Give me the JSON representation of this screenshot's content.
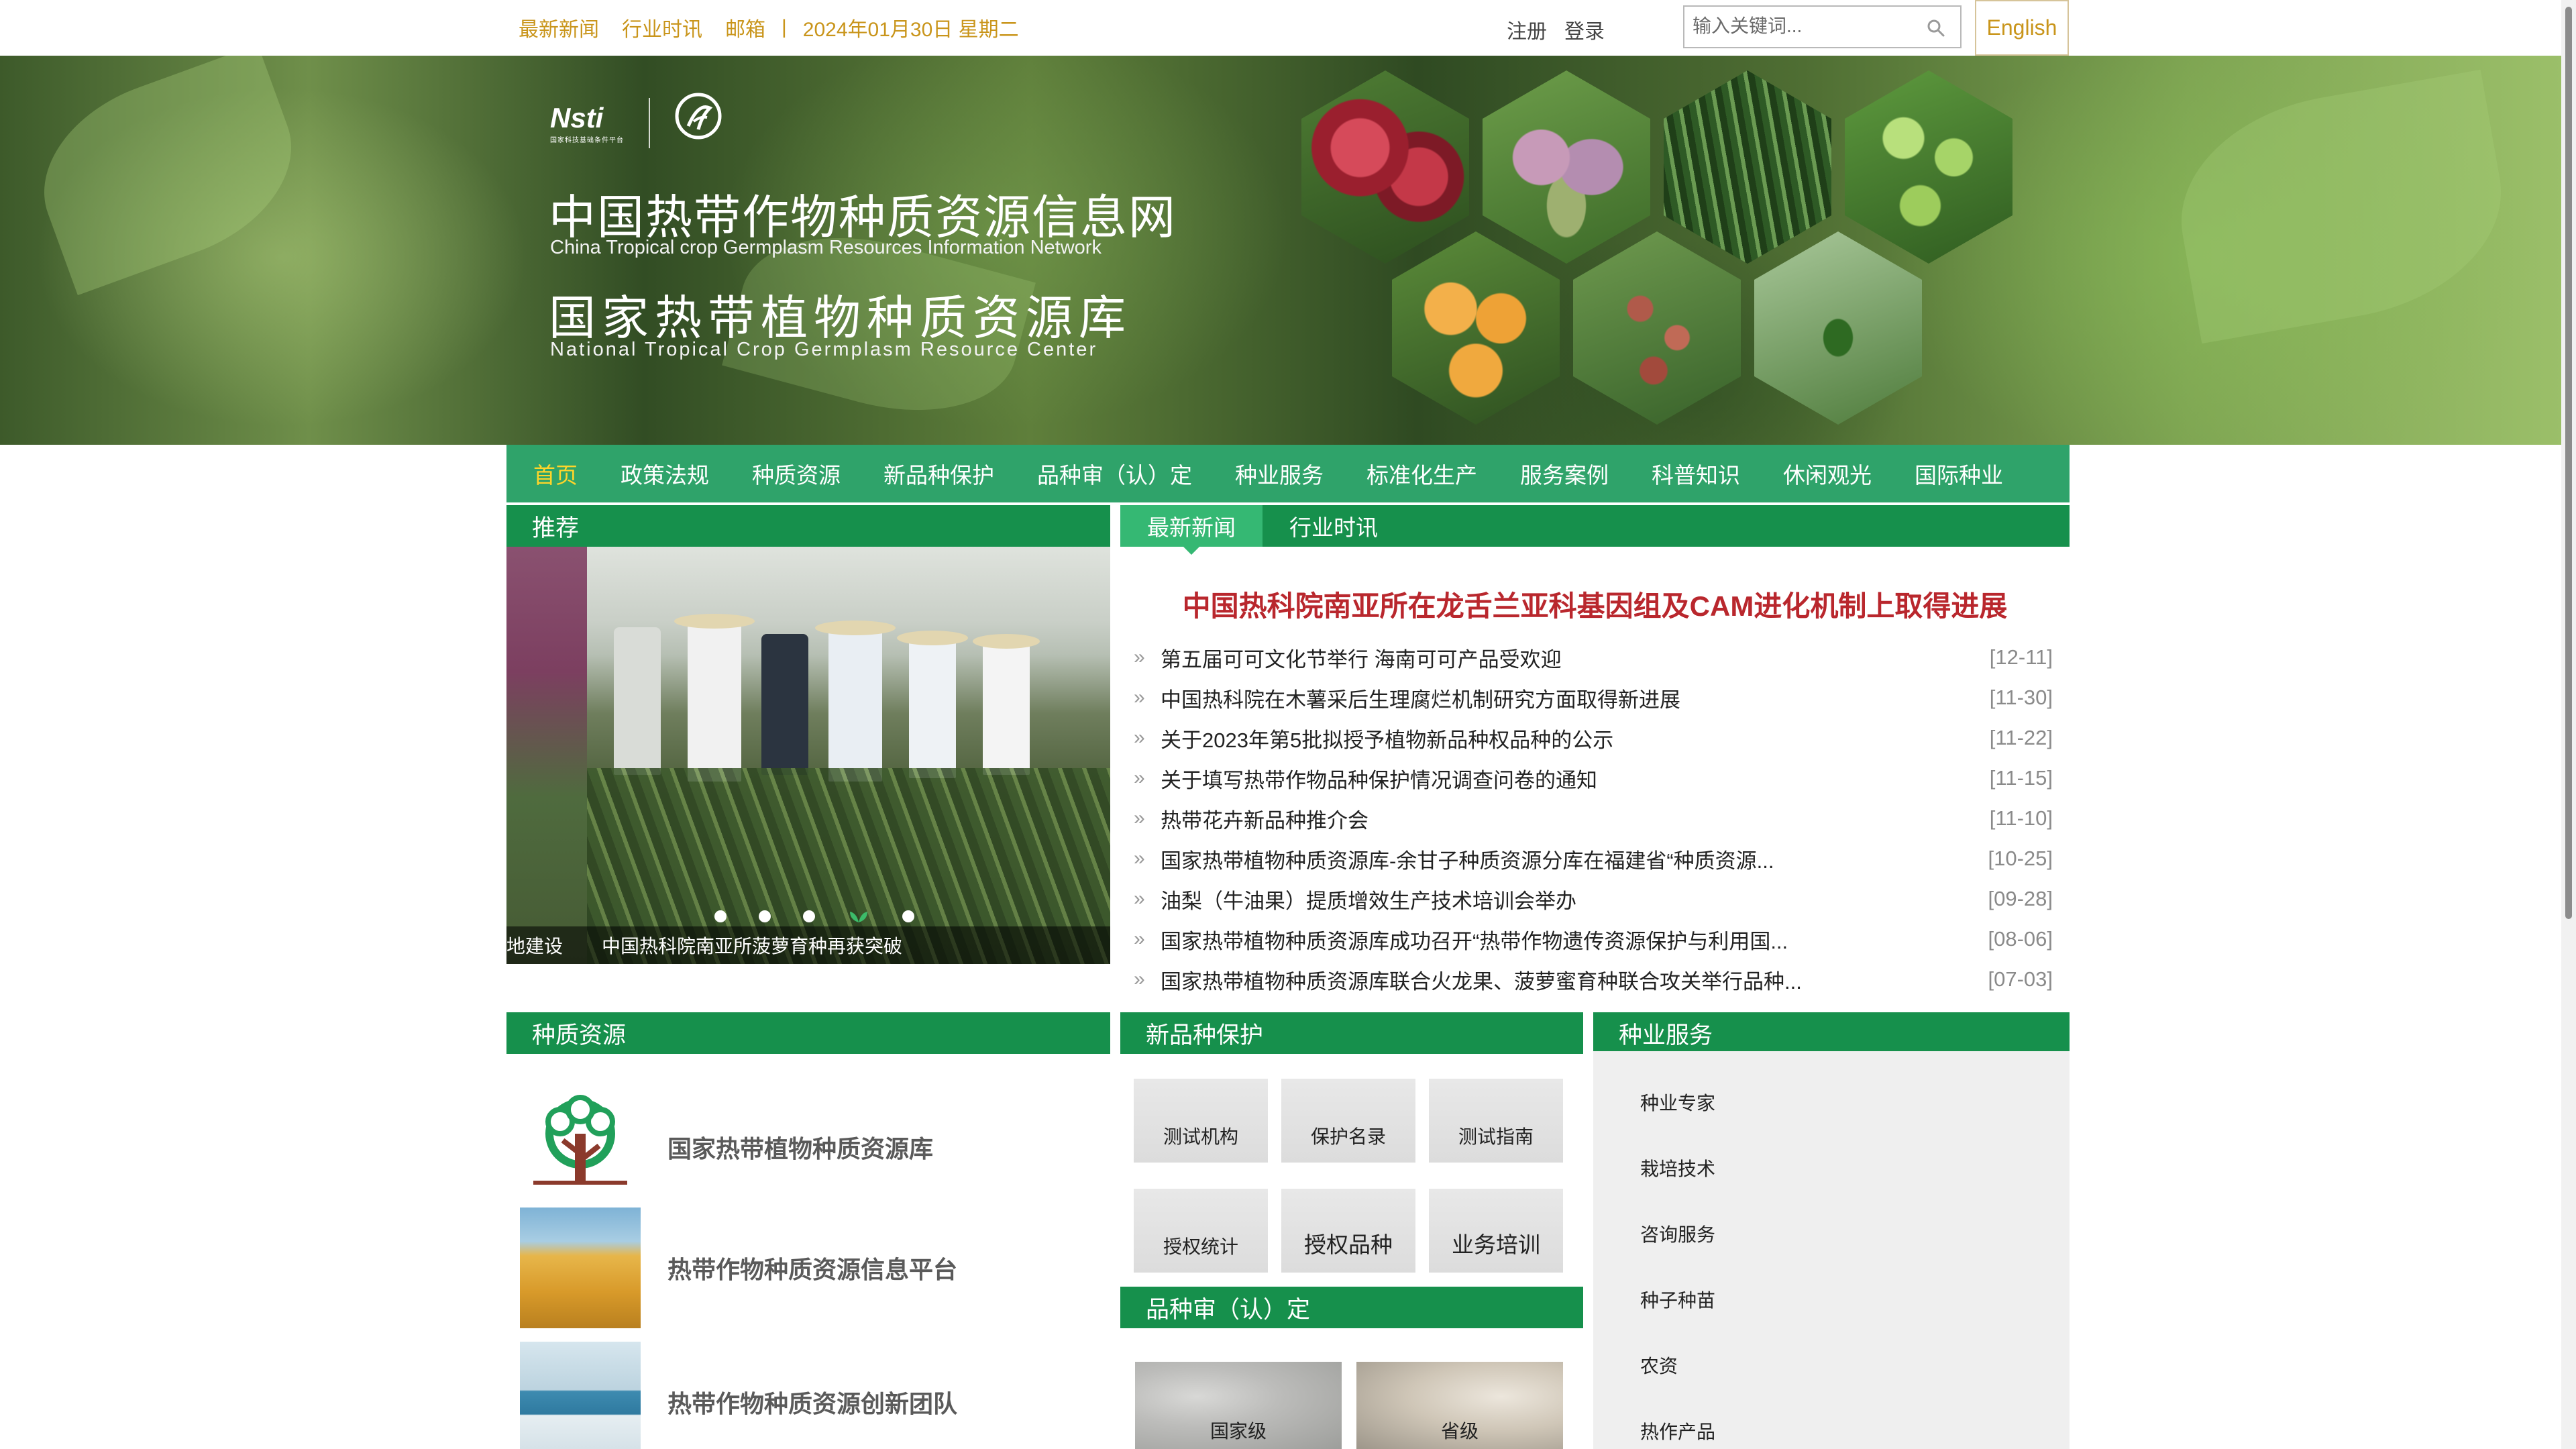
{
  "topbar": {
    "links": [
      "最新新闻",
      "行业时讯",
      "邮箱"
    ],
    "separator": "|",
    "date": "2024年01月30日 星期二",
    "register": "注册",
    "login": "登录",
    "search_placeholder": "输入关键词...",
    "english": "English"
  },
  "banner": {
    "logo_text": "Nsti",
    "logo_subtext": "国家科技基础条件平台",
    "title_cn": "中国热带作物种质资源信息网",
    "title_en": "China Tropical crop Germplasm Resources Information Network",
    "title2_cn": "国家热带植物种质资源库",
    "title2_en": "National Tropical Crop Germplasm Resource Center"
  },
  "nav": {
    "items": [
      "首页",
      "政策法规",
      "种质资源",
      "新品种保护",
      "品种审（认）定",
      "种业服务",
      "标准化生产",
      "服务案例",
      "科普知识",
      "休闲观光",
      "国际种业"
    ],
    "active_index": 0
  },
  "recommend": {
    "header": "推荐",
    "caption_prev": "地建设",
    "caption_main": "中国热科院南亚所菠萝育种再获突破",
    "dot_count": 5,
    "active_dot": 3
  },
  "news": {
    "tabs": [
      "最新新闻",
      "行业时讯"
    ],
    "active_tab": 0,
    "headline": "中国热科院南亚所在龙舌兰亚科基因组及CAM进化机制上取得进展",
    "items": [
      {
        "title": "第五届可可文化节举行 海南可可产品受欢迎",
        "date": "[12-11]"
      },
      {
        "title": "中国热科院在木薯采后生理腐烂机制研究方面取得新进展",
        "date": "[11-30]"
      },
      {
        "title": "关于2023年第5批拟授予植物新品种权品种的公示",
        "date": "[11-22]"
      },
      {
        "title": "关于填写热带作物品种保护情况调查问卷的通知",
        "date": "[11-15]"
      },
      {
        "title": "热带花卉新品种推介会",
        "date": "[11-10]"
      },
      {
        "title": "国家热带植物种质资源库-余甘子种质资源分库在福建省“种质资源...",
        "date": "[10-25]"
      },
      {
        "title": "油梨（牛油果）提质增效生产技术培训会举办",
        "date": "[09-28]"
      },
      {
        "title": "国家热带植物种质资源库成功召开“热带作物遗传资源保护与利用国...",
        "date": "[08-06]"
      },
      {
        "title": "国家热带植物种质资源库联合火龙果、菠萝蜜育种联合攻关举行品种...",
        "date": "[07-03]"
      }
    ]
  },
  "germplasm": {
    "header": "种质资源",
    "items": [
      "国家热带植物种质资源库",
      "热带作物种质资源信息平台",
      "热带作物种质资源创新团队"
    ]
  },
  "protection": {
    "header": "新品种保护",
    "buttons": [
      "测试机构",
      "保护名录",
      "测试指南",
      "授权统计",
      "授权品种",
      "业务培训"
    ]
  },
  "approval": {
    "header": "品种审（认）定",
    "levels": [
      "国家级",
      "省级"
    ]
  },
  "seed_service": {
    "header": "种业服务",
    "items": [
      "种业专家",
      "栽培技术",
      "咨询服务",
      "种子种苗",
      "农资",
      "热作产品"
    ]
  },
  "colors": {
    "nav_green": "#2fa36a",
    "section_green": "#16904c",
    "active_tab_green": "#35b873",
    "gold_link": "#c9951b",
    "active_nav": "#ffd52a",
    "headline_red": "#b9272d"
  }
}
